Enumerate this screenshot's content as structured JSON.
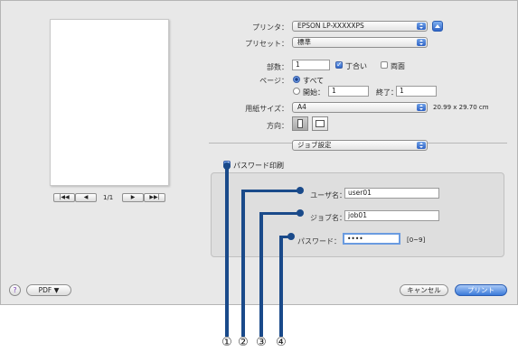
{
  "printer": {
    "label": "プリンタ：",
    "value": "EPSON LP-XXXXXPS"
  },
  "preset": {
    "label": "プリセット：",
    "value": "標準"
  },
  "copies": {
    "label": "部数：",
    "value": "1",
    "collate_label": "丁合い",
    "collate": true,
    "duplex_label": "両面",
    "duplex": false
  },
  "pages": {
    "label": "ページ：",
    "all_label": "すべて",
    "from_label": "開始：",
    "from_value": "1",
    "to_label": "終了：",
    "to_value": "1"
  },
  "paper": {
    "label": "用紙サイズ：",
    "value": "A4",
    "size_text": "20.99 x 29.70 cm"
  },
  "orientation": {
    "label": "方向："
  },
  "section_popup": {
    "value": "ジョブ設定"
  },
  "password_print": {
    "label": "パスワード印刷",
    "checked": true
  },
  "user_name": {
    "label": "ユーザ名：",
    "value": "user01"
  },
  "job_name": {
    "label": "ジョブ名：",
    "value": "job01"
  },
  "password": {
    "label": "パスワード：",
    "value": "••••",
    "hint": "[0~9]"
  },
  "preview_nav": {
    "first": "|◀◀",
    "prev": "◀",
    "page": "1/1",
    "next": "▶",
    "last": "▶▶|"
  },
  "footer": {
    "help": "?",
    "pdf_label": "PDF ▼",
    "cancel_label": "キャンセル",
    "print_label": "プリント"
  },
  "annotations": [
    "①",
    "②",
    "③",
    "④"
  ],
  "colors": {
    "accent": "#2f63c6",
    "annotation": "#1a4a8a"
  }
}
